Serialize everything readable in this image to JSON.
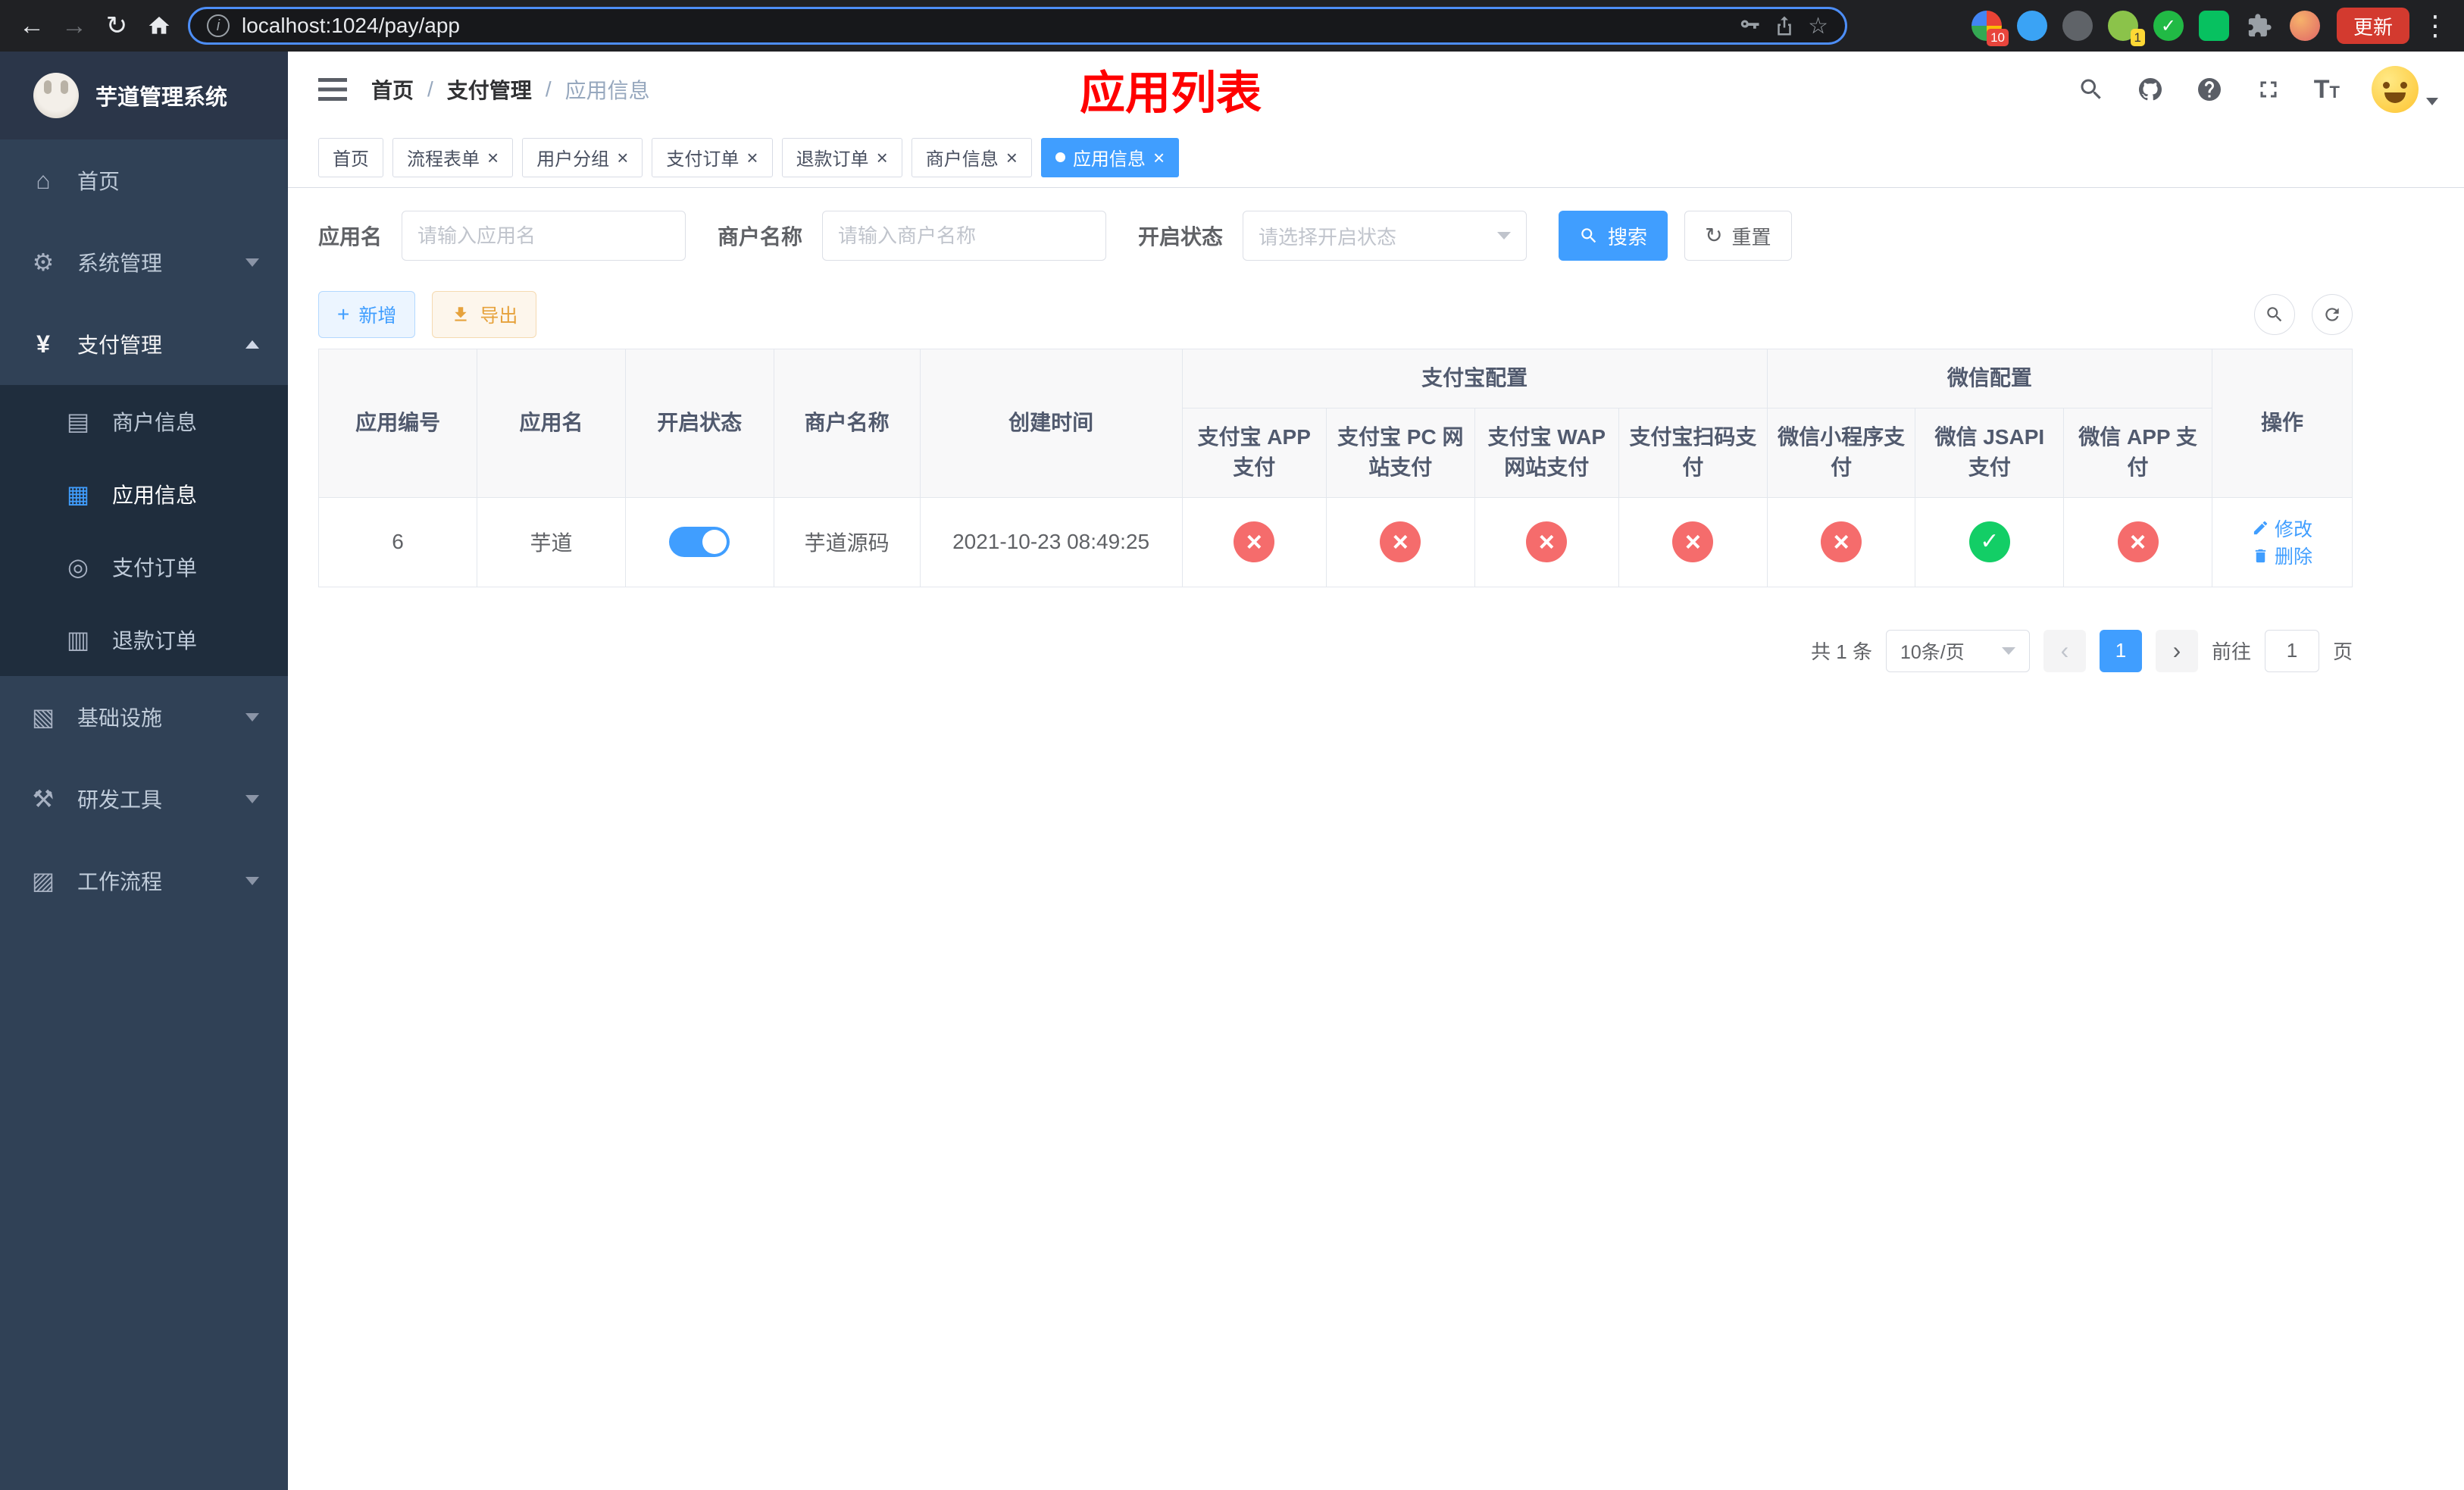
{
  "colors": {
    "accent": "#409eff",
    "success": "#13ce66",
    "danger": "#f56c6c",
    "warning": "#e6a23c",
    "title_red": "#ff0000",
    "sidebar_bg": "#304156"
  },
  "icons": {
    "back": "←",
    "forward": "→",
    "reload": "↻",
    "info": "i",
    "star": "☆",
    "kebab": "⋮",
    "menu_home": "⌂",
    "menu_system": "⚙",
    "menu_pay": "¥",
    "menu_merchant": "▤",
    "menu_app": "▦",
    "menu_pay_order": "◎",
    "menu_refund": "▥",
    "menu_infra": "▧",
    "menu_devtool": "⚒",
    "menu_workflow": "▨",
    "plus": "+",
    "refresh": "↻",
    "close": "×",
    "check": "✓",
    "prev": "‹",
    "next": "›",
    "font_size": "T"
  },
  "browser": {
    "url": "localhost:1024/pay/app",
    "update_button": "更新",
    "ext_badge_1": "10",
    "ext_badge_2": "1"
  },
  "sidebar": {
    "logo_title": "芋道管理系统",
    "menu": [
      {
        "label": "首页"
      },
      {
        "label": "系统管理"
      },
      {
        "label": "支付管理"
      },
      {
        "label": "商户信息"
      },
      {
        "label": "应用信息"
      },
      {
        "label": "支付订单"
      },
      {
        "label": "退款订单"
      },
      {
        "label": "基础设施"
      },
      {
        "label": "研发工具"
      },
      {
        "label": "工作流程"
      }
    ]
  },
  "header": {
    "separator": "/",
    "breadcrumb": [
      {
        "label": "首页"
      },
      {
        "label": "支付管理"
      },
      {
        "label": "应用信息"
      }
    ],
    "page_title": "应用列表"
  },
  "tabs": [
    {
      "label": "首页"
    },
    {
      "label": "流程表单"
    },
    {
      "label": "用户分组"
    },
    {
      "label": "支付订单"
    },
    {
      "label": "退款订单"
    },
    {
      "label": "商户信息"
    },
    {
      "label": "应用信息"
    }
  ],
  "filters": {
    "app_name_label": "应用名",
    "app_name_placeholder": "请输入应用名",
    "merchant_label": "商户名称",
    "merchant_placeholder": "请输入商户名称",
    "status_label": "开启状态",
    "status_placeholder": "请选择开启状态",
    "search_button": "搜索",
    "reset_button": "重置"
  },
  "toolbar": {
    "add_button": "新增",
    "export_button": "导出"
  },
  "table": {
    "columns": {
      "app_id": "应用编号",
      "app_name": "应用名",
      "status": "开启状态",
      "merchant": "商户名称",
      "created_at": "创建时间",
      "alipay_group": "支付宝配置",
      "wechat_group": "微信配置",
      "alipay_app": "支付宝 APP 支付",
      "alipay_pc": "支付宝 PC 网站支付",
      "alipay_wap": "支付宝 WAP 网站支付",
      "alipay_qr": "支付宝扫码支付",
      "wx_lite": "微信小程序支付",
      "wx_jsapi": "微信 JSAPI 支付",
      "wx_app": "微信 APP 支付",
      "actions": "操作"
    },
    "row": {
      "app_id": "6",
      "app_name": "芋道",
      "status": "on",
      "merchant": "芋道源码",
      "created_at": "2021-10-23 08:49:25",
      "alipay_app": "no",
      "alipay_pc": "no",
      "alipay_wap": "no",
      "alipay_qr": "no",
      "wx_lite": "no",
      "wx_jsapi": "yes",
      "wx_app": "no",
      "edit_link": "修改",
      "delete_link": "删除"
    }
  },
  "pagination": {
    "total_text": "共 1 条",
    "page_size": "10条/页",
    "current_page": "1",
    "goto_label": "前往",
    "goto_value": "1",
    "goto_suffix": "页"
  }
}
